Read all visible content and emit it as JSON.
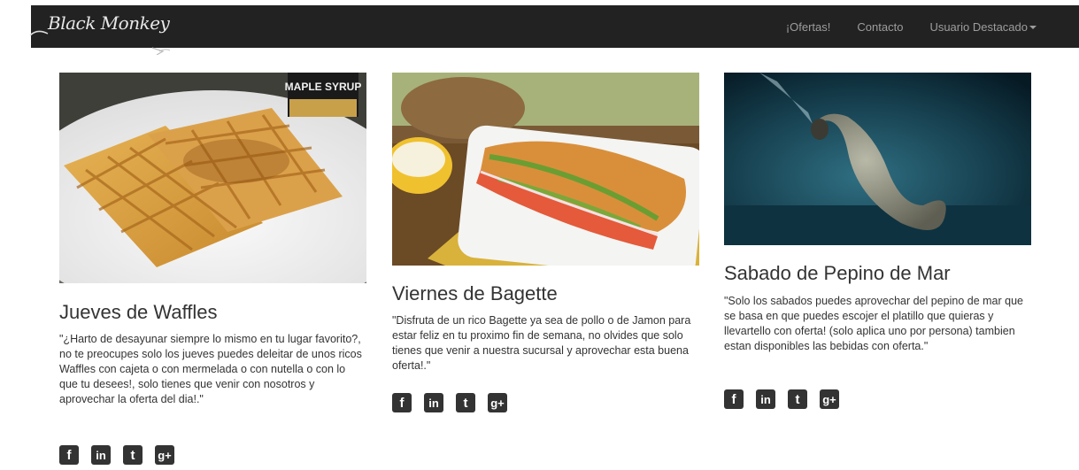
{
  "brand": {
    "name": "Black Monkey"
  },
  "nav": {
    "offers": "¡Ofertas!",
    "contact": "Contacto",
    "featured_user": "Usuario Destacado"
  },
  "cards": [
    {
      "title": "Jueves de Waffles",
      "text": "\"¿Harto de desayunar siempre lo mismo en tu lugar favorito?, no te preocupes solo los jueves puedes deleitar de unos ricos Waffles con cajeta o con mermelada o con nutella o con lo que tu desees!, solo tienes que venir con nosotros y aprovechar la oferta del dia!.\"",
      "image_label": "MAPLE SYRUP"
    },
    {
      "title": "Viernes de Bagette",
      "text": "\"Disfruta de un rico Bagette ya sea de pollo o de Jamon para estar feliz en tu proximo fin de semana, no olvides que solo tienes que venir a nuestra sucursal y aprovechar esta buena oferta!.\""
    },
    {
      "title": "Sabado de Pepino de Mar",
      "text": "\"Solo los sabados puedes aprovechar del pepino de mar que se basa en que puedes escojer el platillo que quieras y llevartello con oferta! (solo aplica uno por persona) tambien estan disponibles las bebidas con oferta.\""
    }
  ],
  "social": {
    "facebook": "f",
    "linkedin": "in",
    "twitter": "t",
    "googleplus": "g+"
  },
  "colors": {
    "navbar": "#222222",
    "nav_text": "#9d9d9d"
  }
}
